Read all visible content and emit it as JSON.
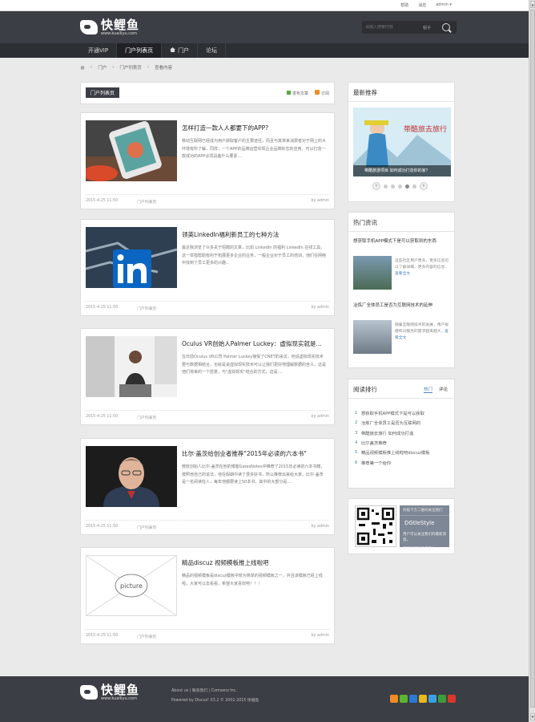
{
  "topbar": {
    "links": [
      "帮助",
      "消息",
      "admin ▾"
    ]
  },
  "brand": {
    "name": "快鲤鱼",
    "url": "www.kuailiyu.com"
  },
  "search": {
    "placeholder": "请输入搜索内容",
    "scope": "帖子"
  },
  "nav": {
    "items": [
      "开通VIP",
      "门户列表页",
      "门户",
      "论坛"
    ],
    "active_index": 1
  },
  "breadcrumb": [
    "门户",
    "门户列表页",
    "查看内容"
  ],
  "section": {
    "title": "门户列表页",
    "publish_label": "发布文章",
    "rss_label": "订阅"
  },
  "articles": [
    {
      "title": "怎样打造一款人人都要下的APP?",
      "excerpt": "移动互联网已经成为用户获取客户的主要途径，而且与其将来消费者对于网上的大环境有所了解，同样，一个APP的品牌运营实现企业品牌标志的应用，可以打造一款成功的APP必须具备什么要素....",
      "date": "2015-4-25 11:50",
      "category": "门户列表页",
      "author_prefix": "by",
      "author": "admin",
      "thumb": "phone-on-table"
    },
    {
      "title": "领英LinkedIn福利新员工的七种方法",
      "excerpt": "最近我浏览了众多关于招聘的文章，比如 LinkedIn 的福利 LinkedIn 在线工具，这一举措帮助有利于拓展更多企业的业务，一般企业对于员工的培训，他们在网络中找到了员工更多的兴趣...",
      "date": "2015-4-25 11:50",
      "category": "门户列表页",
      "author_prefix": "by",
      "author": "admin",
      "thumb": "linkedin-logo"
    },
    {
      "title": "Oculus VR创始人Palmer Luckey：虚拟现实就是...",
      "excerpt": "在日前Oculus VR公司 Palmer Luckey接受了CNET的采访，他说虚拟现实技术要与数据相结合，也就是说虚拟现实技术可以让我们更好地理解数据的含义，这是他们将来的一个愿景，与\"虚拟现实\"结合的方式，这是....",
      "date": "2015-4-25 11:50",
      "category": "门户列表页",
      "author_prefix": "by",
      "author": "admin",
      "thumb": "person-in-office"
    },
    {
      "title": "比尔·盖茨给创业者推荐\"2015年必读的六本书\"",
      "excerpt": "微软创始人比尔·盖茨在他的博客GatesNotes中推荐了2015年必读的六本书籍，按照他自己的说法，他在假期中读了很多好书，所以推荐出来给大家。比尔·盖茨是一名阅读狂人，每年他都要读上50本书，其中的大部分是....",
      "date": "2015-4-25 11:50",
      "category": "门户列表页",
      "author_prefix": "by",
      "author": "admin",
      "thumb": "portrait"
    },
    {
      "title": "精品discuz 视频模板推上线啦吧",
      "excerpt": "精品的视频模板是discuz模板中较为简单的视频模板之一，并且该模板已经上线啦，大家可以去看看，希望大家喜欢吧！！！",
      "date": "2015-4-25 11:50",
      "category": "门户列表页",
      "author_prefix": "by",
      "author": "admin",
      "thumb": "placeholder",
      "thumb_label": "picture"
    }
  ],
  "sidebar": {
    "recommend": {
      "title": "最新推荐",
      "slide_caption": "带酷旅游项目 如何成功打造你的家？",
      "slide_headline": "带酷旅去旅行",
      "slide_count": 5,
      "slide_active": 3
    },
    "hot": {
      "title": "热门资讯",
      "items": [
        {
          "title": "想获取手机APP模式下是可以获取到的东西",
          "desc": "这些社区用户更多，更多信息可以了解详细，更多内容的信息..",
          "more": "查看全文"
        },
        {
          "title": "冶炼厂全体员工是否为互联网技术的延伸",
          "desc": "随着互联网技术的发展，用户规模和对服务的需求越来越大..",
          "more": "查看全文"
        }
      ]
    },
    "rank": {
      "title": "阅读排行",
      "tabs": [
        "热门",
        "评论"
      ],
      "active_tab": 0,
      "items": [
        "想获取手机APP模式下是可以获取",
        "冶炼厂全体员工是否为互联网的",
        "带酷旅去旅行 如何成功打造",
        "比尔盖茨推荐",
        "精品视频模板推上线啦吧discuz模板",
        "推荐第一个给你"
      ]
    },
    "qr": {
      "caption": "扫描下方二维码关注我们",
      "brand": "DGtleStyle",
      "desc1": "用户可以关注我们的最新消息，",
      "desc2": "每天更新更多内容！"
    }
  },
  "footer": {
    "line1": "About us | 联系我们 | Comsenz Inc.",
    "line2": "Powered by Discuz! X3.2 © 2001-2015 快鲤鱼"
  },
  "colors": {
    "header_bg": "#3b3e44",
    "nav_bg": "#2c2f33",
    "link_blue": "#4a7fc1"
  }
}
